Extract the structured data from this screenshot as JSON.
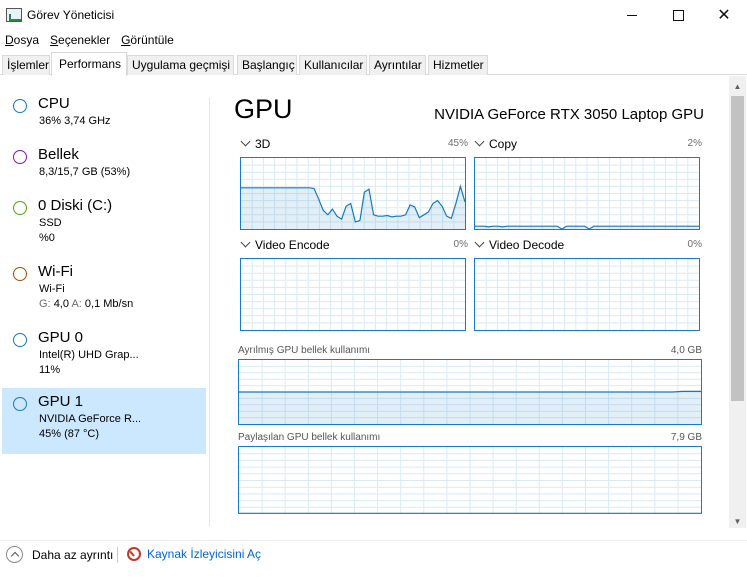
{
  "window": {
    "title": "Görev Yöneticisi",
    "minimize_icon": "minimize-icon",
    "maximize_icon": "maximize-icon",
    "close_icon": "close-icon",
    "close_glyph": "✕"
  },
  "menu": [
    "Dosya",
    "Seçenekler",
    "Görüntüle"
  ],
  "tabs": [
    "İşlemler",
    "Performans",
    "Uygulama geçmişi",
    "Başlangıç",
    "Kullanıcılar",
    "Ayrıntılar",
    "Hizmetler"
  ],
  "active_tab": "Performans",
  "sidebar": {
    "items": [
      {
        "title": "CPU",
        "line1": "36% 3,74 GHz",
        "line2": "",
        "color": "#1779ba"
      },
      {
        "title": "Bellek",
        "line1": "8,3/15,7 GB (53%)",
        "line2": "",
        "color": "#8b12ae"
      },
      {
        "title": "0 Diski (C:)",
        "line1": "SSD",
        "line2": "%0",
        "color": "#4da60c"
      },
      {
        "title": "Wi-Fi",
        "line1": "Wi-Fi",
        "line2_g_label": "G:",
        "line2_g": "4,0",
        "line2_a_label": "A:",
        "line2_a": "0,1 Mb/sn",
        "color": "#a74f01"
      },
      {
        "title": "GPU 0",
        "line1": "Intel(R) UHD Grap...",
        "line2": "11%",
        "color": "#1779ba"
      },
      {
        "title": "GPU 1",
        "line1": "NVIDIA GeForce R...",
        "line2": "45% (87 °C)",
        "color": "#1779ba",
        "selected": true
      }
    ]
  },
  "main": {
    "title": "GPU",
    "model": "NVIDIA GeForce RTX 3050 Laptop GPU",
    "engines": [
      {
        "name": "3D",
        "percent": "45%"
      },
      {
        "name": "Copy",
        "percent": "2%"
      },
      {
        "name": "Video Encode",
        "percent": "0%"
      },
      {
        "name": "Video Decode",
        "percent": "0%"
      }
    ],
    "dedicated_memory": {
      "label": "Ayrılmış GPU bellek kullanımı",
      "value": "4,0 GB"
    },
    "shared_memory": {
      "label": "Paylaşılan GPU bellek kullanımı",
      "value": "7,9 GB"
    },
    "series": {
      "3d": [
        58,
        58,
        58,
        58,
        58,
        58,
        58,
        58,
        58,
        58,
        58,
        58,
        58,
        58,
        58,
        58,
        57,
        42,
        26,
        20,
        28,
        18,
        14,
        32,
        36,
        10,
        12,
        52,
        56,
        20,
        18,
        18,
        19,
        17,
        18,
        18,
        20,
        34,
        31,
        16,
        20,
        24,
        36,
        40,
        32,
        18,
        15,
        36,
        60,
        38
      ],
      "copy": [
        4,
        4,
        4,
        3,
        4,
        4,
        3,
        4,
        4,
        4,
        4,
        4,
        4,
        4,
        4,
        4,
        4,
        4,
        4,
        0,
        4,
        4,
        4,
        4,
        4,
        0,
        4,
        4,
        4,
        4,
        4,
        4,
        4,
        4,
        4,
        4,
        4,
        4,
        4,
        4,
        4,
        4,
        4,
        4,
        4,
        4,
        4,
        4,
        4,
        4
      ],
      "dedicated": [
        50,
        50,
        50,
        50,
        50,
        50,
        50,
        50,
        50,
        50,
        50,
        50,
        50,
        50,
        50,
        50,
        50,
        50,
        50,
        50,
        50,
        50,
        50,
        50,
        50,
        50,
        50,
        50,
        50,
        50,
        50,
        50,
        50,
        50,
        50,
        50,
        50,
        50,
        50,
        50,
        50,
        50,
        50,
        50,
        50,
        50,
        50,
        51,
        51,
        51
      ],
      "shared": [
        1,
        1,
        1,
        1,
        1,
        1,
        1,
        1,
        1,
        1,
        1,
        1,
        1,
        1,
        1,
        1,
        1,
        1,
        1,
        1,
        1,
        1,
        1,
        1,
        1,
        1,
        1,
        1,
        1,
        1,
        1,
        1,
        1,
        1,
        1,
        1,
        1,
        1,
        1,
        1,
        1,
        1,
        1,
        1,
        1,
        1,
        1,
        1,
        1,
        1
      ]
    }
  },
  "status": {
    "fewer_details": "Daha az ayrıntı",
    "resource_monitor": "Kaynak İzleyicisini Aç"
  },
  "colors": {
    "accent": "#1779ba",
    "selected_bg": "#cce8ff",
    "link": "#0066cc"
  }
}
